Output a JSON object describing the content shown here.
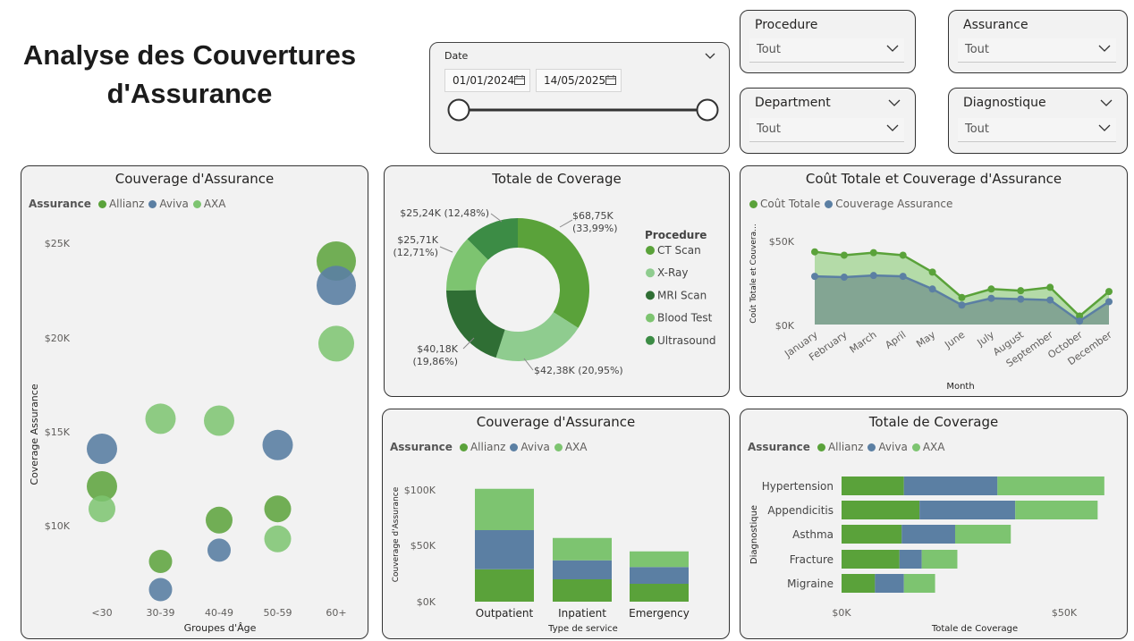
{
  "page": {
    "title": "Analyse des Couvertures d'Assurance"
  },
  "colors": {
    "allianz": "#5aa23a",
    "aviva": "#5b7fa3",
    "axa": "#7dc470"
  },
  "slicers": {
    "date": {
      "label": "Date",
      "start": "01/01/2024",
      "end": "14/05/2025"
    },
    "procedure": {
      "label": "Procedure",
      "value": "Tout"
    },
    "assurance": {
      "label": "Assurance",
      "value": "Tout"
    },
    "department": {
      "label": "Department",
      "value": "Tout"
    },
    "diagnostique": {
      "label": "Diagnostique",
      "value": "Tout"
    }
  },
  "charts": {
    "scatter": {
      "title": "Couverage d'Assurance",
      "legend_title": "Assurance",
      "legend": [
        "Allianz",
        "Aviva",
        "AXA"
      ],
      "xlabel": "Groupes d'Âge",
      "ylabel": "Coverage Assurance",
      "ytick_labels": [
        "$25K",
        "$20K",
        "$15K",
        "$10K"
      ]
    },
    "donut": {
      "title": "Totale de Coverage",
      "legend_title": "Procedure",
      "legend": [
        "CT Scan",
        "X-Ray",
        "MRI Scan",
        "Blood Test",
        "Ultrasound"
      ],
      "slice_labels": [
        [
          "$68,75K",
          "(33,99%)"
        ],
        [
          "$42,38K (20,95%)"
        ],
        [
          "$40,18K",
          "(19,86%)"
        ],
        [
          "$25,71K",
          "(12,71%)"
        ],
        [
          "$25,24K (12,48%)"
        ]
      ]
    },
    "area": {
      "title": "Coût Totale et Couverage d'Assurance",
      "legend": [
        "Coût Totale",
        "Couverage Assurance"
      ],
      "xlabel": "Month",
      "ylabel": "Coût Totale et Couvera...",
      "ytick_labels": [
        "$50K",
        "$0K"
      ]
    },
    "stacked_col": {
      "title": "Couverage d'Assurance",
      "legend_title": "Assurance",
      "legend": [
        "Allianz",
        "Aviva",
        "AXA"
      ],
      "xlabel": "Type de service",
      "ylabel": "Couverage d'Assurance",
      "ytick_labels": [
        "$100K",
        "$50K",
        "$0K"
      ]
    },
    "stacked_bar": {
      "title": "Totale de Coverage",
      "legend_title": "Assurance",
      "legend": [
        "Allianz",
        "Aviva",
        "AXA"
      ],
      "xlabel": "Totale de Coverage",
      "ylabel": "Diagnostique",
      "xtick_labels": [
        "$0K",
        "$50K"
      ]
    }
  },
  "chart_data": [
    {
      "type": "scatter",
      "title": "Couverage d'Assurance",
      "xlabel": "Groupes d'Âge",
      "ylabel": "Coverage Assurance",
      "categories": [
        "<30",
        "30-39",
        "40-49",
        "50-59",
        "60+"
      ],
      "ylim": [
        4500,
        27000
      ],
      "series": [
        {
          "name": "Allianz",
          "values": [
            12000,
            8000,
            10200,
            10800,
            24000
          ]
        },
        {
          "name": "Aviva",
          "values": [
            14000,
            6500,
            8600,
            14200,
            22700
          ]
        },
        {
          "name": "AXA",
          "values": [
            10800,
            15600,
            15500,
            9200,
            19600
          ]
        }
      ]
    },
    {
      "type": "pie",
      "title": "Totale de Coverage",
      "categories": [
        "CT Scan",
        "X-Ray",
        "MRI Scan",
        "Blood Test",
        "Ultrasound"
      ],
      "values": [
        68750,
        42380,
        40180,
        25710,
        25240
      ],
      "percent": [
        33.99,
        20.95,
        19.86,
        12.71,
        12.48
      ],
      "colors": [
        "#5aa23a",
        "#8fcc8f",
        "#2f6e34",
        "#7dc470",
        "#3c8c45"
      ]
    },
    {
      "type": "area",
      "title": "Coût Totale et Couverage d'Assurance",
      "xlabel": "Month",
      "ylabel": "Coût Totale et Couvera...",
      "categories": [
        "January",
        "February",
        "March",
        "April",
        "May",
        "June",
        "July",
        "August",
        "September",
        "October",
        "December"
      ],
      "ylim": [
        0,
        60000
      ],
      "series": [
        {
          "name": "Coût Totale",
          "values": [
            43000,
            41000,
            42500,
            41000,
            31000,
            16000,
            21000,
            20000,
            22000,
            5000,
            19500
          ]
        },
        {
          "name": "Couverage Assurance",
          "values": [
            28500,
            28000,
            29000,
            28500,
            21000,
            11500,
            15500,
            15000,
            14500,
            2000,
            13500
          ]
        }
      ]
    },
    {
      "type": "bar",
      "title": "Couverage d'Assurance",
      "xlabel": "Type de service",
      "ylabel": "Couverage d'Assurance",
      "categories": [
        "Outpatient",
        "Inpatient",
        "Emergency"
      ],
      "ylim": [
        0,
        110000
      ],
      "series": [
        {
          "name": "Allianz",
          "values": [
            29000,
            20000,
            16000
          ]
        },
        {
          "name": "Aviva",
          "values": [
            35000,
            17000,
            15000
          ]
        },
        {
          "name": "AXA",
          "values": [
            37000,
            20000,
            14000
          ]
        }
      ]
    },
    {
      "type": "bar",
      "orientation": "horizontal",
      "title": "Totale de Coverage",
      "xlabel": "Totale de Coverage",
      "ylabel": "Diagnostique",
      "categories": [
        "Hypertension",
        "Appendicitis",
        "Asthma",
        "Fracture",
        "Migraine"
      ],
      "xlim": [
        0,
        64000
      ],
      "series": [
        {
          "name": "Allianz",
          "values": [
            14000,
            17500,
            13500,
            13000,
            7500
          ]
        },
        {
          "name": "Aviva",
          "values": [
            21000,
            21500,
            12000,
            5000,
            6500
          ]
        },
        {
          "name": "AXA",
          "values": [
            24000,
            18500,
            12500,
            8000,
            7000
          ]
        }
      ]
    }
  ]
}
